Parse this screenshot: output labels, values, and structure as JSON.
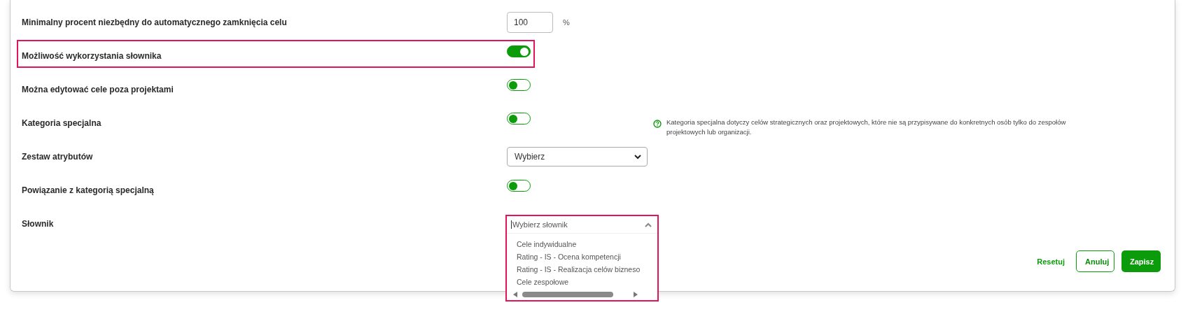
{
  "rows": [
    {
      "kind": "number",
      "label": "Minimalny procent niezbędny do automatycznego zamknięcia celu",
      "value": "100",
      "unit": "%",
      "highlighted": false
    },
    {
      "kind": "toggle",
      "label": "Możliwość wykorzystania słownika",
      "on": true,
      "highlighted": true
    },
    {
      "kind": "toggle",
      "label": "Można edytować cele poza projektami",
      "on": false,
      "highlighted": false
    },
    {
      "kind": "toggle",
      "label": "Kategoria specjalna",
      "on": false,
      "highlighted": false,
      "help": "Kategoria specjalna dotyczy celów strategicznych oraz projektowych, które nie są przypisywane do konkretnych osób tylko do zespołów projektowych lub organizacji."
    },
    {
      "kind": "select",
      "label": "Zestaw atrybutów",
      "value": "Wybierz",
      "highlighted": false
    },
    {
      "kind": "toggle",
      "label": "Powiązanie z kategorią specjalną",
      "on": false,
      "highlighted": false
    },
    {
      "kind": "dictionary",
      "label": "Słownik",
      "placeholder": "Wybierz słownik",
      "expanded": true,
      "highlighted": true,
      "options": [
        "Cele indywidualne",
        "Rating - IS - Ocena kompetencji",
        "Rating - IS - Realizacja celów bizneso",
        "Cele zespołowe"
      ]
    }
  ],
  "buttons": [
    {
      "kind": "link",
      "label": "Resetuj"
    },
    {
      "kind": "outline",
      "label": "Anuluj"
    },
    {
      "kind": "primary",
      "label": "Zapisz"
    }
  ]
}
